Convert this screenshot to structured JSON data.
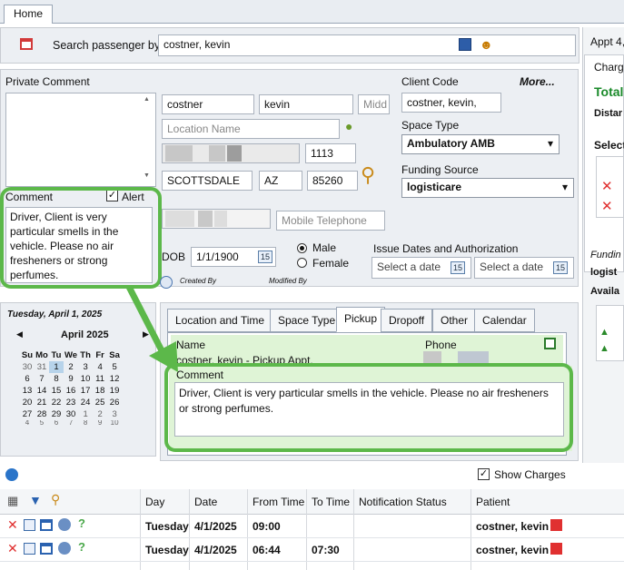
{
  "tabs": {
    "home": "Home"
  },
  "search": {
    "label": "Search passenger by:",
    "value": "costner, kevin"
  },
  "appt_header": "Appt 4,",
  "right_panel": {
    "charges_label": "Charg",
    "total_label": "Total",
    "distance_label": "Distar",
    "select_label": "Select",
    "funding_label": "Fundin",
    "funding_value": "logist",
    "available_label": "Availa"
  },
  "private_comment": {
    "label": "Private Comment",
    "value": ""
  },
  "comment": {
    "label": "Comment",
    "alert_label": "Alert",
    "alert_checked": true,
    "text": "Driver, Client is very particular smells in the vehicle. Please no air fresheners or strong perfumes."
  },
  "client": {
    "last_name": "costner",
    "first_name": "kevin",
    "middle_placeholder": "Midd",
    "location_placeholder": "Location Name",
    "street_no": "1113",
    "city": "SCOTTSDALE",
    "state": "AZ",
    "zip": "85260",
    "mobile_placeholder": "Mobile Telephone"
  },
  "client_code": {
    "label": "Client Code",
    "more": "More...",
    "value": "costner, kevin,"
  },
  "space_type": {
    "label": "Space Type",
    "value": "Ambulatory AMB"
  },
  "funding_source": {
    "label": "Funding Source",
    "value": "logisticare"
  },
  "dob": {
    "label": "DOB",
    "value": "1/1/1900",
    "male": "Male",
    "female": "Female",
    "selected": "Male"
  },
  "issue": {
    "label": "Issue Dates and Authorization",
    "date_placeholder_1": "Select a date",
    "date_placeholder_2": "Select a date"
  },
  "created_by": "Created By",
  "modified_by": "Modified By",
  "calendar": {
    "date_title": "Tuesday, April 1, 2025",
    "month": "April 2025",
    "days": [
      "Su",
      "Mo",
      "Tu",
      "We",
      "Th",
      "Fr",
      "Sa"
    ],
    "weeks": [
      [
        "30",
        "31",
        "1",
        "2",
        "3",
        "4",
        "5"
      ],
      [
        "6",
        "7",
        "8",
        "9",
        "10",
        "11",
        "12"
      ],
      [
        "13",
        "14",
        "15",
        "16",
        "17",
        "18",
        "19"
      ],
      [
        "20",
        "21",
        "22",
        "23",
        "24",
        "25",
        "26"
      ],
      [
        "27",
        "28",
        "29",
        "30",
        "1",
        "2",
        "3"
      ],
      [
        "4",
        "5",
        "6",
        "7",
        "8",
        "9",
        "10"
      ]
    ],
    "selected": "1"
  },
  "detail_tabs": [
    "Location and Time",
    "Space Type",
    "Pickup",
    "Dropoff",
    "Other",
    "Calendar"
  ],
  "active_tab": "Pickup",
  "pickup": {
    "name_label": "Name",
    "phone_label": "Phone",
    "name_value": "costner, kevin - Pickup Appt.",
    "comment_label": "Comment",
    "comment_text": "Driver, Client is very particular smells in the vehicle. Please no air fresheners or strong perfumes."
  },
  "show_charges": "Show Charges",
  "trip_grid": {
    "columns": [
      "Day",
      "Date",
      "From Time",
      "To Time",
      "Notification Status",
      "Patient"
    ],
    "rows": [
      {
        "day": "Tuesday",
        "date": "4/1/2025",
        "from": "09:00",
        "to": "",
        "status": "",
        "patient": "costner, kevin"
      },
      {
        "day": "Tuesday",
        "date": "4/1/2025",
        "from": "06:44",
        "to": "07:30",
        "status": "",
        "patient": "costner, kevin"
      }
    ]
  },
  "colors": {
    "highlight_green": "#5cb84a",
    "panel_bg": "#eceff3",
    "accent_red": "#e03030",
    "selected_day": "#b7d3ea"
  }
}
